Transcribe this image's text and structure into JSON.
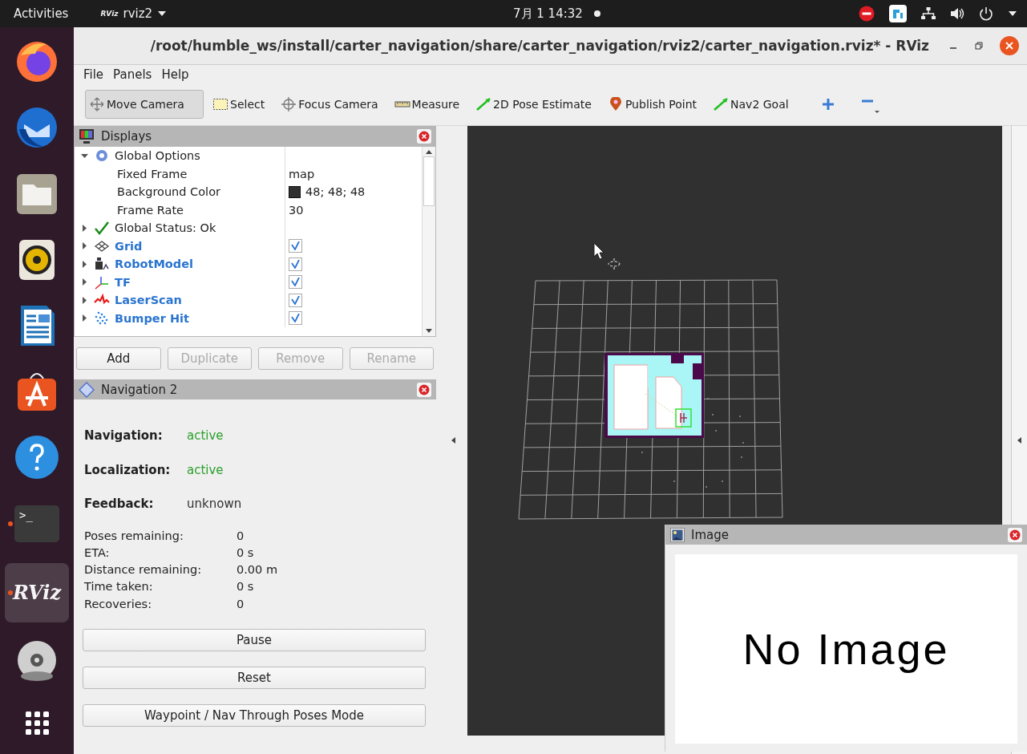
{
  "top_bar": {
    "activities": "Activities",
    "app_icon_label": "RViz",
    "app_name": "rviz2",
    "clock": "7月 1  14:32",
    "notification": true
  },
  "dock": {
    "items": [
      {
        "running": false,
        "selected": false
      },
      {
        "running": false,
        "selected": false
      },
      {
        "running": false,
        "selected": false
      },
      {
        "running": false,
        "selected": false
      },
      {
        "running": false,
        "selected": false
      },
      {
        "running": false,
        "selected": false
      },
      {
        "running": false,
        "selected": false
      },
      {
        "label": ">_",
        "running": true,
        "selected": false
      },
      {
        "label": "RViz",
        "running": true,
        "selected": true
      },
      {
        "running": false,
        "selected": false
      },
      {
        "running": false,
        "selected": false
      }
    ]
  },
  "window": {
    "title": "/root/humble_ws/install/carter_navigation/share/carter_navigation/rviz2/carter_navigation.rviz* - RViz"
  },
  "menu": [
    "File",
    "Panels",
    "Help"
  ],
  "tools": [
    {
      "label": "Move Camera",
      "selected": true
    },
    {
      "label": "Select",
      "selected": false
    },
    {
      "label": "Focus Camera",
      "selected": false
    },
    {
      "label": "Measure",
      "selected": false
    },
    {
      "label": "2D Pose Estimate",
      "selected": false
    },
    {
      "label": "Publish Point",
      "selected": false
    },
    {
      "label": "Nav2 Goal",
      "selected": false
    }
  ],
  "displays": {
    "title": "Displays",
    "tree": [
      {
        "kind": "options",
        "label": "Global Options",
        "expanded": true,
        "children": [
          {
            "label": "Fixed Frame",
            "value": "map"
          },
          {
            "label": "Background Color",
            "value": "48; 48; 48",
            "color": "#303030"
          },
          {
            "label": "Frame Rate",
            "value": "30"
          }
        ]
      },
      {
        "kind": "status",
        "label": "Global Status: Ok",
        "expanded": false
      },
      {
        "kind": "grid",
        "label": "Grid",
        "expanded": false,
        "checked": true
      },
      {
        "kind": "robot",
        "label": "RobotModel",
        "expanded": false,
        "checked": true
      },
      {
        "kind": "tf",
        "label": "TF",
        "expanded": false,
        "checked": true
      },
      {
        "kind": "laser",
        "label": "LaserScan",
        "expanded": false,
        "checked": true
      },
      {
        "kind": "bumper",
        "label": "Bumper Hit",
        "expanded": false,
        "checked": true
      }
    ],
    "buttons": [
      {
        "label": "Add",
        "disabled": false
      },
      {
        "label": "Duplicate",
        "disabled": true
      },
      {
        "label": "Remove",
        "disabled": true
      },
      {
        "label": "Rename",
        "disabled": true
      }
    ]
  },
  "navigation": {
    "title": "Navigation 2",
    "status": [
      {
        "label": "Navigation:",
        "value": "active",
        "color": "#2ca02c"
      },
      {
        "label": "Localization:",
        "value": "active",
        "color": "#2ca02c"
      },
      {
        "label": "Feedback:",
        "value": "unknown",
        "color": "#303030"
      }
    ],
    "metrics": [
      {
        "label": "Poses remaining:",
        "value": "0"
      },
      {
        "label": "ETA:",
        "value": "0 s"
      },
      {
        "label": "Distance remaining:",
        "value": "0.00 m"
      },
      {
        "label": "Time taken:",
        "value": "0 s"
      },
      {
        "label": "Recoveries:",
        "value": "0"
      }
    ],
    "buttons": [
      "Pause",
      "Reset",
      "Waypoint / Nav Through Poses Mode"
    ]
  },
  "image_panel": {
    "title": "Image",
    "message": "No Image"
  }
}
